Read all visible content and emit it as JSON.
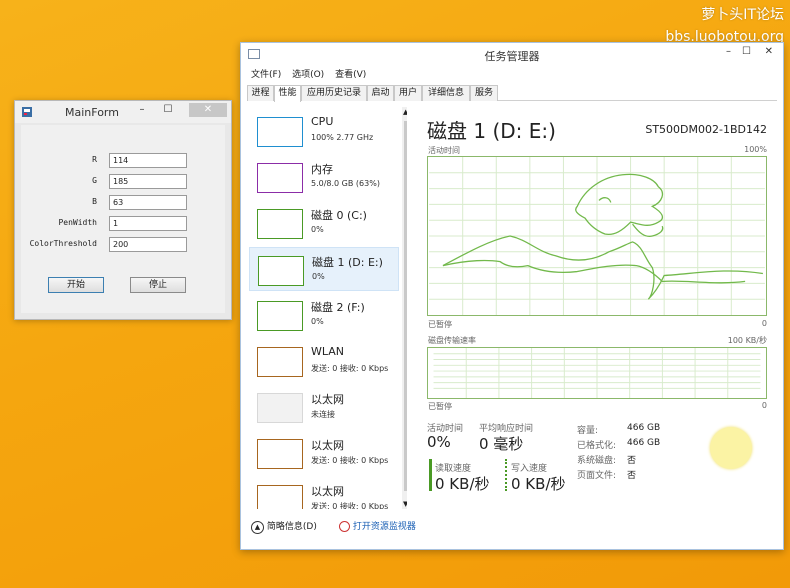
{
  "watermark": {
    "line1": "萝卜头IT论坛",
    "line2": "bbs.luobotou.org"
  },
  "mainform": {
    "title": "MainForm",
    "fields": [
      {
        "label": "R",
        "value": "114"
      },
      {
        "label": "G",
        "value": "185"
      },
      {
        "label": "B",
        "value": "63"
      },
      {
        "label": "PenWidth",
        "value": "1"
      },
      {
        "label": "ColorThreshold",
        "value": "200"
      }
    ],
    "start_label": "开始",
    "stop_label": "停止"
  },
  "taskmgr": {
    "title": "任务管理器",
    "menu": [
      "文件(F)",
      "选项(O)",
      "查看(V)"
    ],
    "tabs": [
      "进程",
      "性能",
      "应用历史记录",
      "启动",
      "用户",
      "详细信息",
      "服务"
    ],
    "active_tab": "性能",
    "sidebar": [
      {
        "name": "CPU",
        "sub": "100% 2.77 GHz",
        "color": "#1f8fd0"
      },
      {
        "name": "内存",
        "sub": "5.0/8.0 GB (63%)",
        "color": "#8b2da7"
      },
      {
        "name": "磁盘 0 (C:)",
        "sub": "0%",
        "color": "#4a9a25"
      },
      {
        "name": "磁盘 1 (D: E:)",
        "sub": "0%",
        "color": "#4a9a25"
      },
      {
        "name": "磁盘 2 (F:)",
        "sub": "0%",
        "color": "#4a9a25"
      },
      {
        "name": "WLAN",
        "sub": "发送: 0 接收: 0 Kbps",
        "color": "#a7661f"
      },
      {
        "name": "以太网",
        "sub": "未连接",
        "color": "#c9c9c9"
      },
      {
        "name": "以太网",
        "sub": "发送: 0 接收: 0 Kbps",
        "color": "#a7661f"
      },
      {
        "name": "以太网",
        "sub": "发送: 0 接收: 0 Kbps",
        "color": "#a7661f"
      }
    ],
    "detail": {
      "title": "磁盘 1 (D: E:)",
      "model": "ST500DM002-1BD142",
      "graph1_label": "活动时间",
      "graph1_max": "100%",
      "graph1_bottom_left": "已暂停",
      "graph1_bottom_right": "0",
      "graph2_label": "磁盘传输速率",
      "graph2_max": "100 KB/秒",
      "graph2_bottom_left": "已暂停",
      "graph2_bottom_right": "0",
      "active_time_label": "活动时间",
      "active_time_value": "0%",
      "response_label": "平均响应时间",
      "response_value": "0 毫秒",
      "read_label": "读取速度",
      "read_value": "0 KB/秒",
      "write_label": "写入速度",
      "write_value": "0 KB/秒",
      "kv": [
        {
          "k": "容量:",
          "v": "466 GB"
        },
        {
          "k": "已格式化:",
          "v": "466 GB"
        },
        {
          "k": "系统磁盘:",
          "v": "否"
        },
        {
          "k": "页面文件:",
          "v": "否"
        }
      ]
    },
    "footer": {
      "less": "简略信息(D)",
      "resmon": "打开资源监视器"
    }
  }
}
